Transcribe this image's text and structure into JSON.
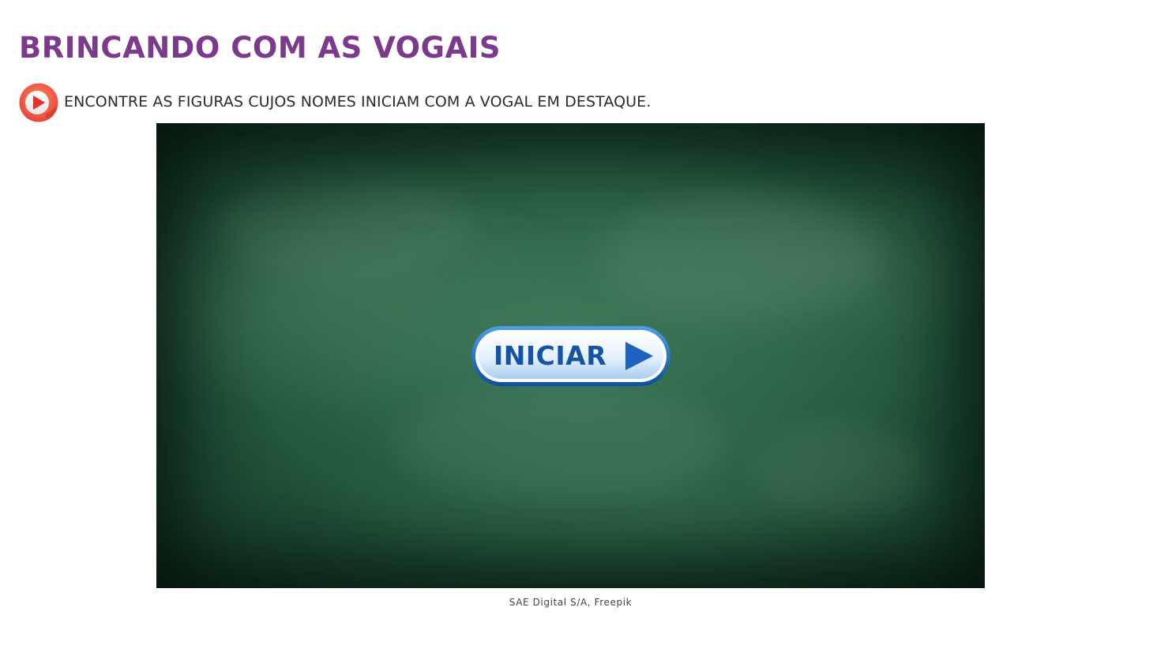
{
  "activity": {
    "title": "BRINCANDO COM AS VOGAIS",
    "title_color": "#7b3a8c",
    "instruction": "ENCONTRE AS FIGURAS CUJOS NOMES INICIAM COM A VOGAL EM DESTAQUE.",
    "audio_icon": "play-audio-icon"
  },
  "stage": {
    "background": "green-chalkboard",
    "start_button": {
      "label": "INICIAR",
      "icon": "play-triangle-icon",
      "text_color": "#1553a6"
    }
  },
  "credit": "SAE Digital S/A, Freepik"
}
